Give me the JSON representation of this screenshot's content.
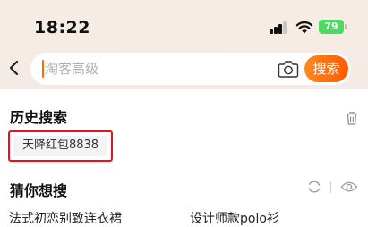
{
  "status_bar": {
    "time": "18:22",
    "battery": "79"
  },
  "search": {
    "placeholder": "淘客高级",
    "button_label": "搜索"
  },
  "history": {
    "title": "历史搜索",
    "items": [
      "天降红包8838"
    ]
  },
  "guess": {
    "title": "猜你想搜",
    "items": [
      "法式初恋别致连衣裙",
      "设计师款polo衫"
    ]
  },
  "colors": {
    "accent": "#ff5a00",
    "highlight_border": "#e8121d",
    "battery": "#4cd964"
  }
}
